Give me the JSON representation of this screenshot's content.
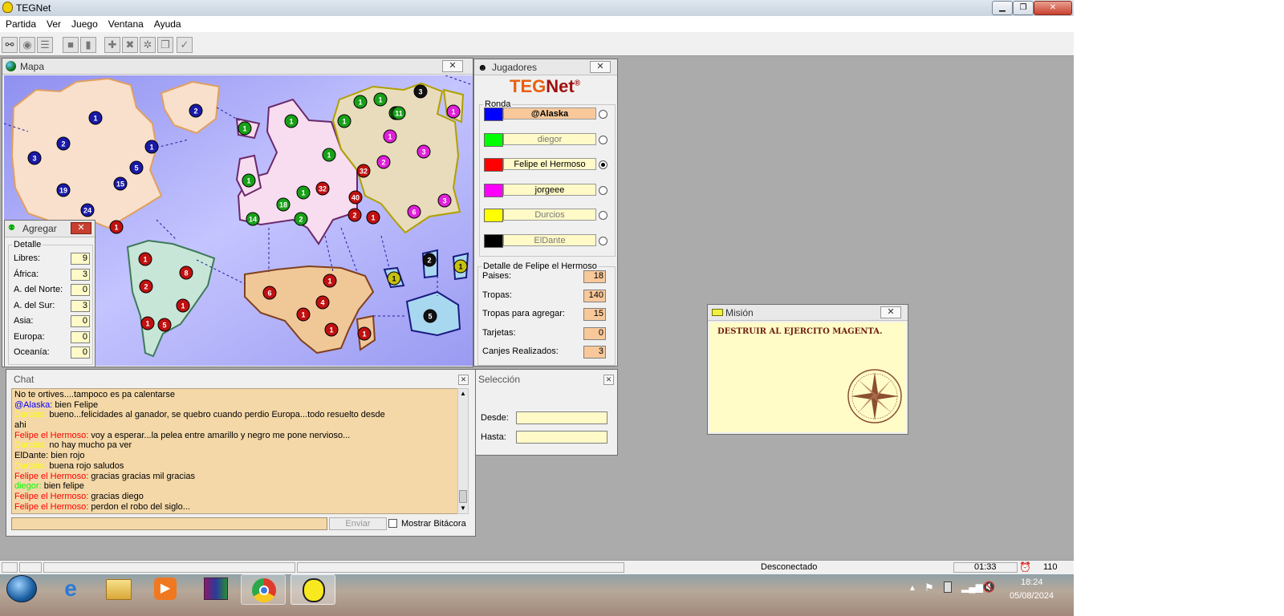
{
  "window": {
    "title": "TEGNet",
    "min_label": "▁",
    "max_label": "❐",
    "close_label": "✕"
  },
  "menu": [
    "Partida",
    "Ver",
    "Juego",
    "Ventana",
    "Ayuda"
  ],
  "colors": {
    "blue": "#1010d8",
    "green": "#10c010",
    "red": "#e00000",
    "magenta": "#e010e0",
    "yellow": "#f0f000",
    "black": "#000000",
    "chat_bg": "#f4d8a8"
  },
  "map_panel": {
    "title": "Mapa"
  },
  "map": {
    "blue": [
      "1",
      "2",
      "2",
      "1",
      "3",
      "5",
      "19",
      "15",
      "24"
    ],
    "green": [
      "1",
      "1",
      "1",
      "1",
      "1",
      "1",
      "10",
      "1",
      "18",
      "1",
      "14",
      "2",
      "1",
      "1",
      "11"
    ],
    "red": [
      "32",
      "32",
      "40",
      "2",
      "1",
      "1",
      "8",
      "2",
      "1",
      "1",
      "5",
      "1",
      "6",
      "4",
      "1",
      "1",
      "1",
      "1"
    ],
    "magenta": [
      "1",
      "1",
      "2",
      "3",
      "6",
      "3"
    ],
    "yellow": [
      "1",
      "1"
    ],
    "black": [
      "3",
      "2",
      "5"
    ]
  },
  "agregar": {
    "title": "Agregar",
    "legend": "Detalle",
    "rows": [
      {
        "label": "Libres:",
        "value": "9"
      },
      {
        "label": "África:",
        "value": "3"
      },
      {
        "label": "A. del Norte:",
        "value": "0"
      },
      {
        "label": "A. del Sur:",
        "value": "3"
      },
      {
        "label": "Asia:",
        "value": "0"
      },
      {
        "label": "Europa:",
        "value": "0"
      },
      {
        "label": "Oceanía:",
        "value": "0"
      }
    ]
  },
  "jugadores": {
    "title": "Jugadores",
    "logo_a": "TEG",
    "logo_b": "Net",
    "logo_mark": "®",
    "ronda_legend": "Ronda",
    "players": [
      {
        "name": "@Alaska",
        "color": "#0000ff"
      },
      {
        "name": "diegor",
        "color": "#00ff00"
      },
      {
        "name": "Felipe el Hermoso",
        "color": "#ff0000"
      },
      {
        "name": "jorgeee",
        "color": "#ff00ff"
      },
      {
        "name": "Durcios",
        "color": "#ffff00"
      },
      {
        "name": "ElDante",
        "color": "#000000"
      }
    ],
    "detalle_legend": "Detalle de Felipe el Hermoso",
    "detalle": [
      {
        "label": "Paises:",
        "value": "18"
      },
      {
        "label": "Tropas:",
        "value": "140"
      },
      {
        "label": "Tropas para agregar:",
        "value": "15"
      },
      {
        "label": "Tarjetas:",
        "value": "0"
      },
      {
        "label": "Canjes Realizados:",
        "value": "3"
      }
    ]
  },
  "chat": {
    "title": "Chat",
    "send_label": "Enviar",
    "show_log_label": "Mostrar Bitácora",
    "messages": [
      {
        "user": "",
        "color": "#000000",
        "text": "No te ortives....tampoco es pa  calentarse"
      },
      {
        "user": "@Alaska:",
        "color": "#0000ff",
        "text": "bien Felipe"
      },
      {
        "user": "Durcios:",
        "color": "#ffff00",
        "text": "bueno...felicidades al ganador,  se quebro cuando perdio Europa...todo resuelto desde"
      },
      {
        "user": "",
        "color": "#000000",
        "text": "ahi"
      },
      {
        "user": "Felipe el Hermoso:",
        "color": "#ff0000",
        "text": "voy a esperar...la pelea entre amarillo y negro me pone nervioso..."
      },
      {
        "user": "Durcios:",
        "color": "#ffff00",
        "text": "no hay mucho pa  ver"
      },
      {
        "user": "ElDante:",
        "color": "#000000",
        "text": "bien rojo"
      },
      {
        "user": "Durcios:",
        "color": "#ffff00",
        "text": "buena  rojo saludos"
      },
      {
        "user": "Felipe el Hermoso:",
        "color": "#ff0000",
        "text": "gracias gracias mil gracias"
      },
      {
        "user": "diegor:",
        "color": "#00ff00",
        "text": "bien felipe"
      },
      {
        "user": "Felipe el Hermoso:",
        "color": "#ff0000",
        "text": "gracias diego"
      },
      {
        "user": "Felipe el Hermoso:",
        "color": "#ff0000",
        "text": "perdon el robo del siglo..."
      }
    ]
  },
  "seleccion": {
    "title": "Selección",
    "desde_label": "Desde:",
    "hasta_label": "Hasta:",
    "desde_value": "",
    "hasta_value": ""
  },
  "mision": {
    "title": "Misión",
    "text": "DESTRUIR AL EJERCITO MAGENTA."
  },
  "statusbar": {
    "connection": "Desconectado",
    "time": "01:33",
    "count": "110"
  },
  "taskbar": {
    "clock_time": "18:24",
    "clock_date": "05/08/2024"
  }
}
